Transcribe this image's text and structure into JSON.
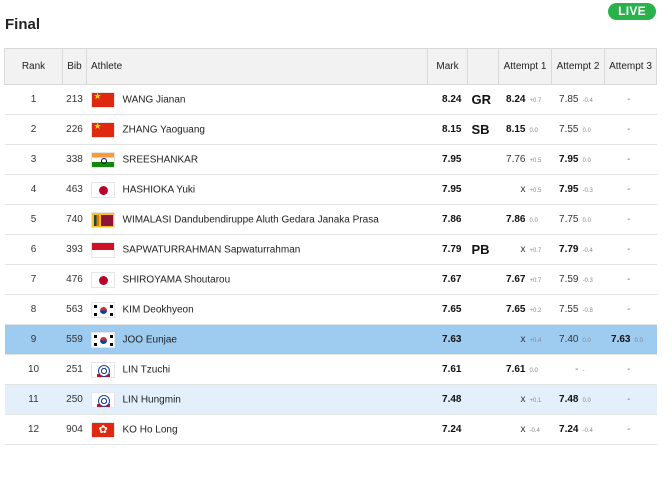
{
  "page": {
    "title": "Final",
    "live_badge": "LIVE",
    "colors": {
      "live": "#29b24a",
      "highlight_row": "#9ecbf0",
      "light_row": "#e3f0fb"
    }
  },
  "table": {
    "headers": {
      "rank": "Rank",
      "bib": "Bib",
      "athlete": "Athlete",
      "mark": "Mark",
      "record": "",
      "attempt1": "Attempt 1",
      "attempt2": "Attempt 2",
      "attempt3": "Attempt 3"
    },
    "rows": [
      {
        "rank": "1",
        "bib": "213",
        "flag": "flag-china-icon",
        "athlete": "WANG Jianan",
        "mark": "8.24",
        "record": "GR",
        "a1": "8.24",
        "w1": "+0.7",
        "a2": "7.85",
        "w2": "-0.4",
        "a3": "-",
        "w3": ""
      },
      {
        "rank": "2",
        "bib": "226",
        "flag": "flag-china-icon",
        "athlete": "ZHANG Yaoguang",
        "mark": "8.15",
        "record": "SB",
        "a1": "8.15",
        "w1": "0.0",
        "a2": "7.55",
        "w2": "0.0",
        "a3": "-",
        "w3": ""
      },
      {
        "rank": "3",
        "bib": "338",
        "flag": "flag-india-icon",
        "athlete": "SREESHANKAR",
        "mark": "7.95",
        "record": "",
        "a1": "7.76",
        "w1": "+0.5",
        "a2": "7.95",
        "w2": "0.0",
        "a3": "-",
        "w3": ""
      },
      {
        "rank": "4",
        "bib": "463",
        "flag": "flag-japan-icon",
        "athlete": "HASHIOKA Yuki",
        "mark": "7.95",
        "record": "",
        "a1": "x",
        "w1": "+0.5",
        "a2": "7.95",
        "w2": "-0.3",
        "a3": "-",
        "w3": ""
      },
      {
        "rank": "5",
        "bib": "740",
        "flag": "flag-sri-lanka-icon",
        "athlete": "WIMALASI Dandubendiruppe Aluth Gedara Janaka Prasa",
        "mark": "7.86",
        "record": "",
        "a1": "7.86",
        "w1": "0.0",
        "a2": "7.75",
        "w2": "0.0",
        "a3": "-",
        "w3": ""
      },
      {
        "rank": "6",
        "bib": "393",
        "flag": "flag-indonesia-icon",
        "athlete": "SAPWATURRAHMAN Sapwaturrahman",
        "mark": "7.79",
        "record": "PB",
        "a1": "x",
        "w1": "+0.7",
        "a2": "7.79",
        "w2": "-0.4",
        "a3": "-",
        "w3": ""
      },
      {
        "rank": "7",
        "bib": "476",
        "flag": "flag-japan-icon",
        "athlete": "SHIROYAMA Shoutarou",
        "mark": "7.67",
        "record": "",
        "a1": "7.67",
        "w1": "+0.7",
        "a2": "7.59",
        "w2": "-0.3",
        "a3": "-",
        "w3": ""
      },
      {
        "rank": "8",
        "bib": "563",
        "flag": "flag-korea-icon",
        "athlete": "KIM Deokhyeon",
        "mark": "7.65",
        "record": "",
        "a1": "7.65",
        "w1": "+0.2",
        "a2": "7.55",
        "w2": "-0.8",
        "a3": "-",
        "w3": ""
      },
      {
        "rank": "9",
        "bib": "559",
        "flag": "flag-korea-icon",
        "athlete": "JOO Eunjae",
        "mark": "7.63",
        "record": "",
        "a1": "x",
        "w1": "+0.4",
        "a2": "7.40",
        "w2": "0.0",
        "a3": "7.63",
        "w3": "0.0"
      },
      {
        "rank": "10",
        "bib": "251",
        "flag": "flag-chinese-taipei-icon",
        "athlete": "LIN Tzuchi",
        "mark": "7.61",
        "record": "",
        "a1": "7.61",
        "w1": "0.0",
        "a2": "-",
        "w2": "-",
        "a3": "-",
        "w3": ""
      },
      {
        "rank": "11",
        "bib": "250",
        "flag": "flag-chinese-taipei-icon",
        "athlete": "LIN Hungmin",
        "mark": "7.48",
        "record": "",
        "a1": "x",
        "w1": "+0.1",
        "a2": "7.48",
        "w2": "0.0",
        "a3": "-",
        "w3": ""
      },
      {
        "rank": "12",
        "bib": "904",
        "flag": "flag-hong-kong-icon",
        "athlete": "KO Ho Long",
        "mark": "7.24",
        "record": "",
        "a1": "x",
        "w1": "-0.4",
        "a2": "7.24",
        "w2": "-0.4",
        "a3": "-",
        "w3": ""
      }
    ]
  }
}
